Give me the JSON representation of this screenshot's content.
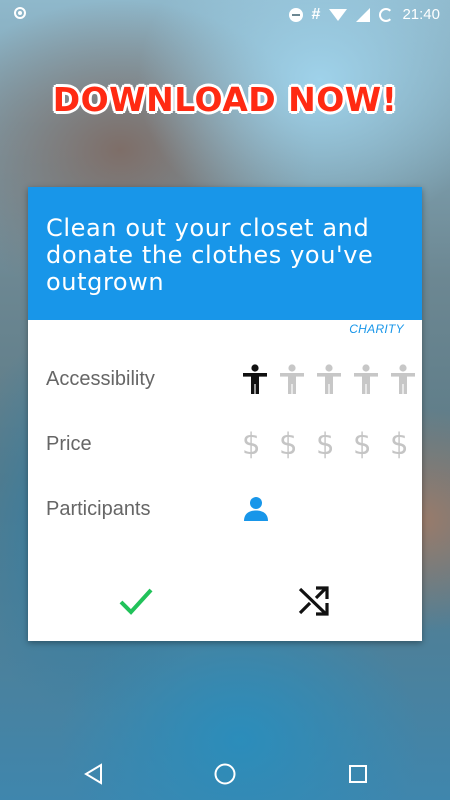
{
  "status_bar": {
    "time": "21:40",
    "icons": [
      "record-icon",
      "do-not-disturb-icon",
      "hashtag-icon",
      "wifi-icon",
      "signal-icon",
      "battery-icon"
    ]
  },
  "banner": {
    "text": "DOWNLOAD NOW!",
    "color": "#ff2a12"
  },
  "card": {
    "title": "Clean out your closet and donate the clothes you've outgrown",
    "header_color": "#1896e9",
    "category": "CHARITY",
    "rows": [
      {
        "label": "Accessibility",
        "icon": "person-icon",
        "max": 5,
        "level": 0.2
      },
      {
        "label": "Price",
        "icon": "dollar",
        "symbol": "$",
        "max": 5,
        "level": 0
      },
      {
        "label": "Participants",
        "icon": "user-icon",
        "count": 1
      }
    ],
    "accept_icon": "checkmark-icon",
    "accept_color": "#21c25a",
    "shuffle_icon": "shuffle-icon"
  },
  "nav_bar": {
    "icons": [
      "back-icon",
      "home-icon",
      "recents-icon"
    ]
  }
}
